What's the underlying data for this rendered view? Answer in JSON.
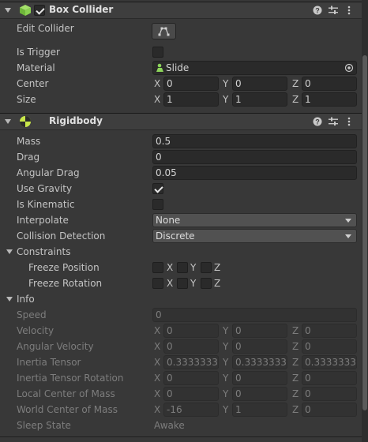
{
  "box_collider": {
    "title": "Box Collider",
    "enabled": true,
    "edit_collider_label": "Edit Collider",
    "is_trigger_label": "Is Trigger",
    "is_trigger": false,
    "material_label": "Material",
    "material_value": "Slide",
    "center_label": "Center",
    "center": {
      "x": "0",
      "y": "0",
      "z": "0"
    },
    "size_label": "Size",
    "size": {
      "x": "1",
      "y": "1",
      "z": "1"
    }
  },
  "rigidbody": {
    "title": "Rigidbody",
    "mass_label": "Mass",
    "mass": "0.5",
    "drag_label": "Drag",
    "drag": "0",
    "angular_drag_label": "Angular Drag",
    "angular_drag": "0.05",
    "use_gravity_label": "Use Gravity",
    "use_gravity": true,
    "is_kinematic_label": "Is Kinematic",
    "is_kinematic": false,
    "interpolate_label": "Interpolate",
    "interpolate": "None",
    "collision_detection_label": "Collision Detection",
    "collision_detection": "Discrete",
    "constraints_label": "Constraints",
    "freeze_position_label": "Freeze Position",
    "freeze_rotation_label": "Freeze Rotation",
    "axis_x": "X",
    "axis_y": "Y",
    "axis_z": "Z",
    "info_label": "Info",
    "speed_label": "Speed",
    "speed": "0",
    "velocity_label": "Velocity",
    "velocity": {
      "x": "0",
      "y": "0",
      "z": "0"
    },
    "angular_velocity_label": "Angular Velocity",
    "angular_velocity": {
      "x": "0",
      "y": "0",
      "z": "0"
    },
    "inertia_tensor_label": "Inertia Tensor",
    "inertia_tensor": {
      "x": "0.3333333",
      "y": "0.3333333",
      "z": "0.3333333"
    },
    "inertia_tensor_rotation_label": "Inertia Tensor Rotation",
    "inertia_tensor_rotation": {
      "x": "0",
      "y": "0",
      "z": "0"
    },
    "local_center_label": "Local Center of Mass",
    "local_center": {
      "x": "0",
      "y": "0",
      "z": "0"
    },
    "world_center_label": "World Center of Mass",
    "world_center": {
      "x": "-16",
      "y": "1",
      "z": "0"
    },
    "sleep_state_label": "Sleep State",
    "sleep_state": "Awake"
  },
  "icons": [
    "fold-arrow-icon",
    "box-collider-icon",
    "rigidbody-icon",
    "help-icon",
    "preset-icon",
    "more-options-icon",
    "edit-collider-icon",
    "physic-material-icon",
    "object-picker-icon",
    "dropdown-arrow-icon"
  ]
}
